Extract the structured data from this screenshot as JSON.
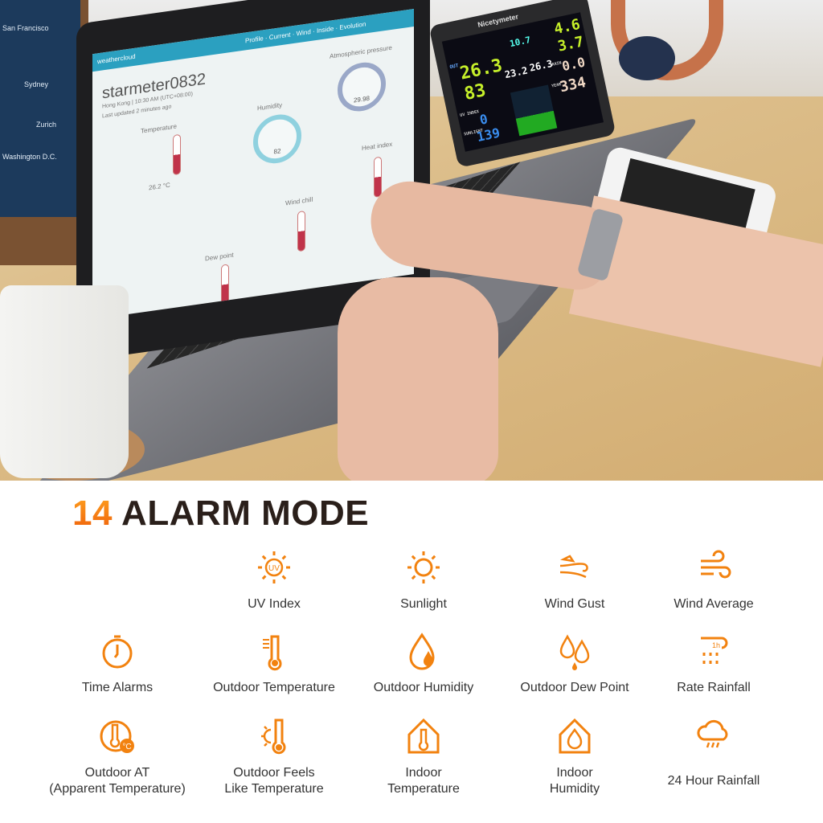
{
  "photo": {
    "posters": [
      "San Francisco",
      "Sydney",
      "Washington D.C.",
      "Zurich"
    ],
    "laptop_screen": {
      "brand": "weathercloud",
      "station_name": "starmeter0832",
      "location": "Hong Kong | 10:30 AM (UTC+08:00)",
      "updated": "Last updated 2 minutes ago",
      "tabs": [
        "Profile",
        "Current",
        "Wind",
        "Inside",
        "Evolution"
      ],
      "temperature_label": "Temperature",
      "temperature_value": "26.2 °C",
      "humidity_label": "Humidity",
      "humidity_value": "82",
      "pressure_label": "Atmospheric pressure",
      "pressure_value": "29.98",
      "wind_chill_label": "Wind chill",
      "heat_index_label": "Heat index",
      "dew_point_label": "Dew point"
    },
    "station_display": {
      "brand": "Nicetymeter",
      "out_label": "OUT",
      "out_temp": "26.3",
      "out_humidity": "83",
      "in_temp": "23.2",
      "feels_temp": "26.3",
      "wind_dir": "10.7",
      "wind_gust": "4.6",
      "wind_avg": "3.7",
      "rain_label": "RAIN",
      "rain": "0.0",
      "year_label": "YEAR",
      "rain_year": "334",
      "uv_label": "UV INDEX",
      "uv": "0",
      "sunlight_label": "SUNLIGHT",
      "sunlight": "139"
    }
  },
  "header": {
    "count": "14",
    "title": "ALARM MODE"
  },
  "accent_color": "#f2820f",
  "alarm_modes": [
    {
      "label": "UV Index",
      "icon": "uv-sun-icon"
    },
    {
      "label": "Sunlight",
      "icon": "sun-icon"
    },
    {
      "label": "Wind Gust",
      "icon": "wind-gust-leaves-icon"
    },
    {
      "label": "Wind Average",
      "icon": "wind-icon"
    },
    {
      "label": "Time Alarms",
      "icon": "stopwatch-icon"
    },
    {
      "label": "Outdoor Temperature",
      "icon": "thermometer-icon"
    },
    {
      "label": "Outdoor Humidity",
      "icon": "humidity-drop-icon"
    },
    {
      "label": "Outdoor Dew Point",
      "icon": "dew-drops-icon"
    },
    {
      "label": "Rate Rainfall",
      "icon": "hourly-rain-icon"
    },
    {
      "label": "Outdoor AT\n(Apparent Temperature)",
      "icon": "apparent-temperature-icon"
    },
    {
      "label": "Outdoor Feels\nLike Temperature",
      "icon": "feels-like-icon"
    },
    {
      "label": "Indoor\nTemperature",
      "icon": "indoor-temperature-icon"
    },
    {
      "label": "Indoor\nHumidity",
      "icon": "indoor-humidity-icon"
    },
    {
      "label": "24 Hour Rainfall",
      "icon": "rain-cloud-icon"
    }
  ]
}
